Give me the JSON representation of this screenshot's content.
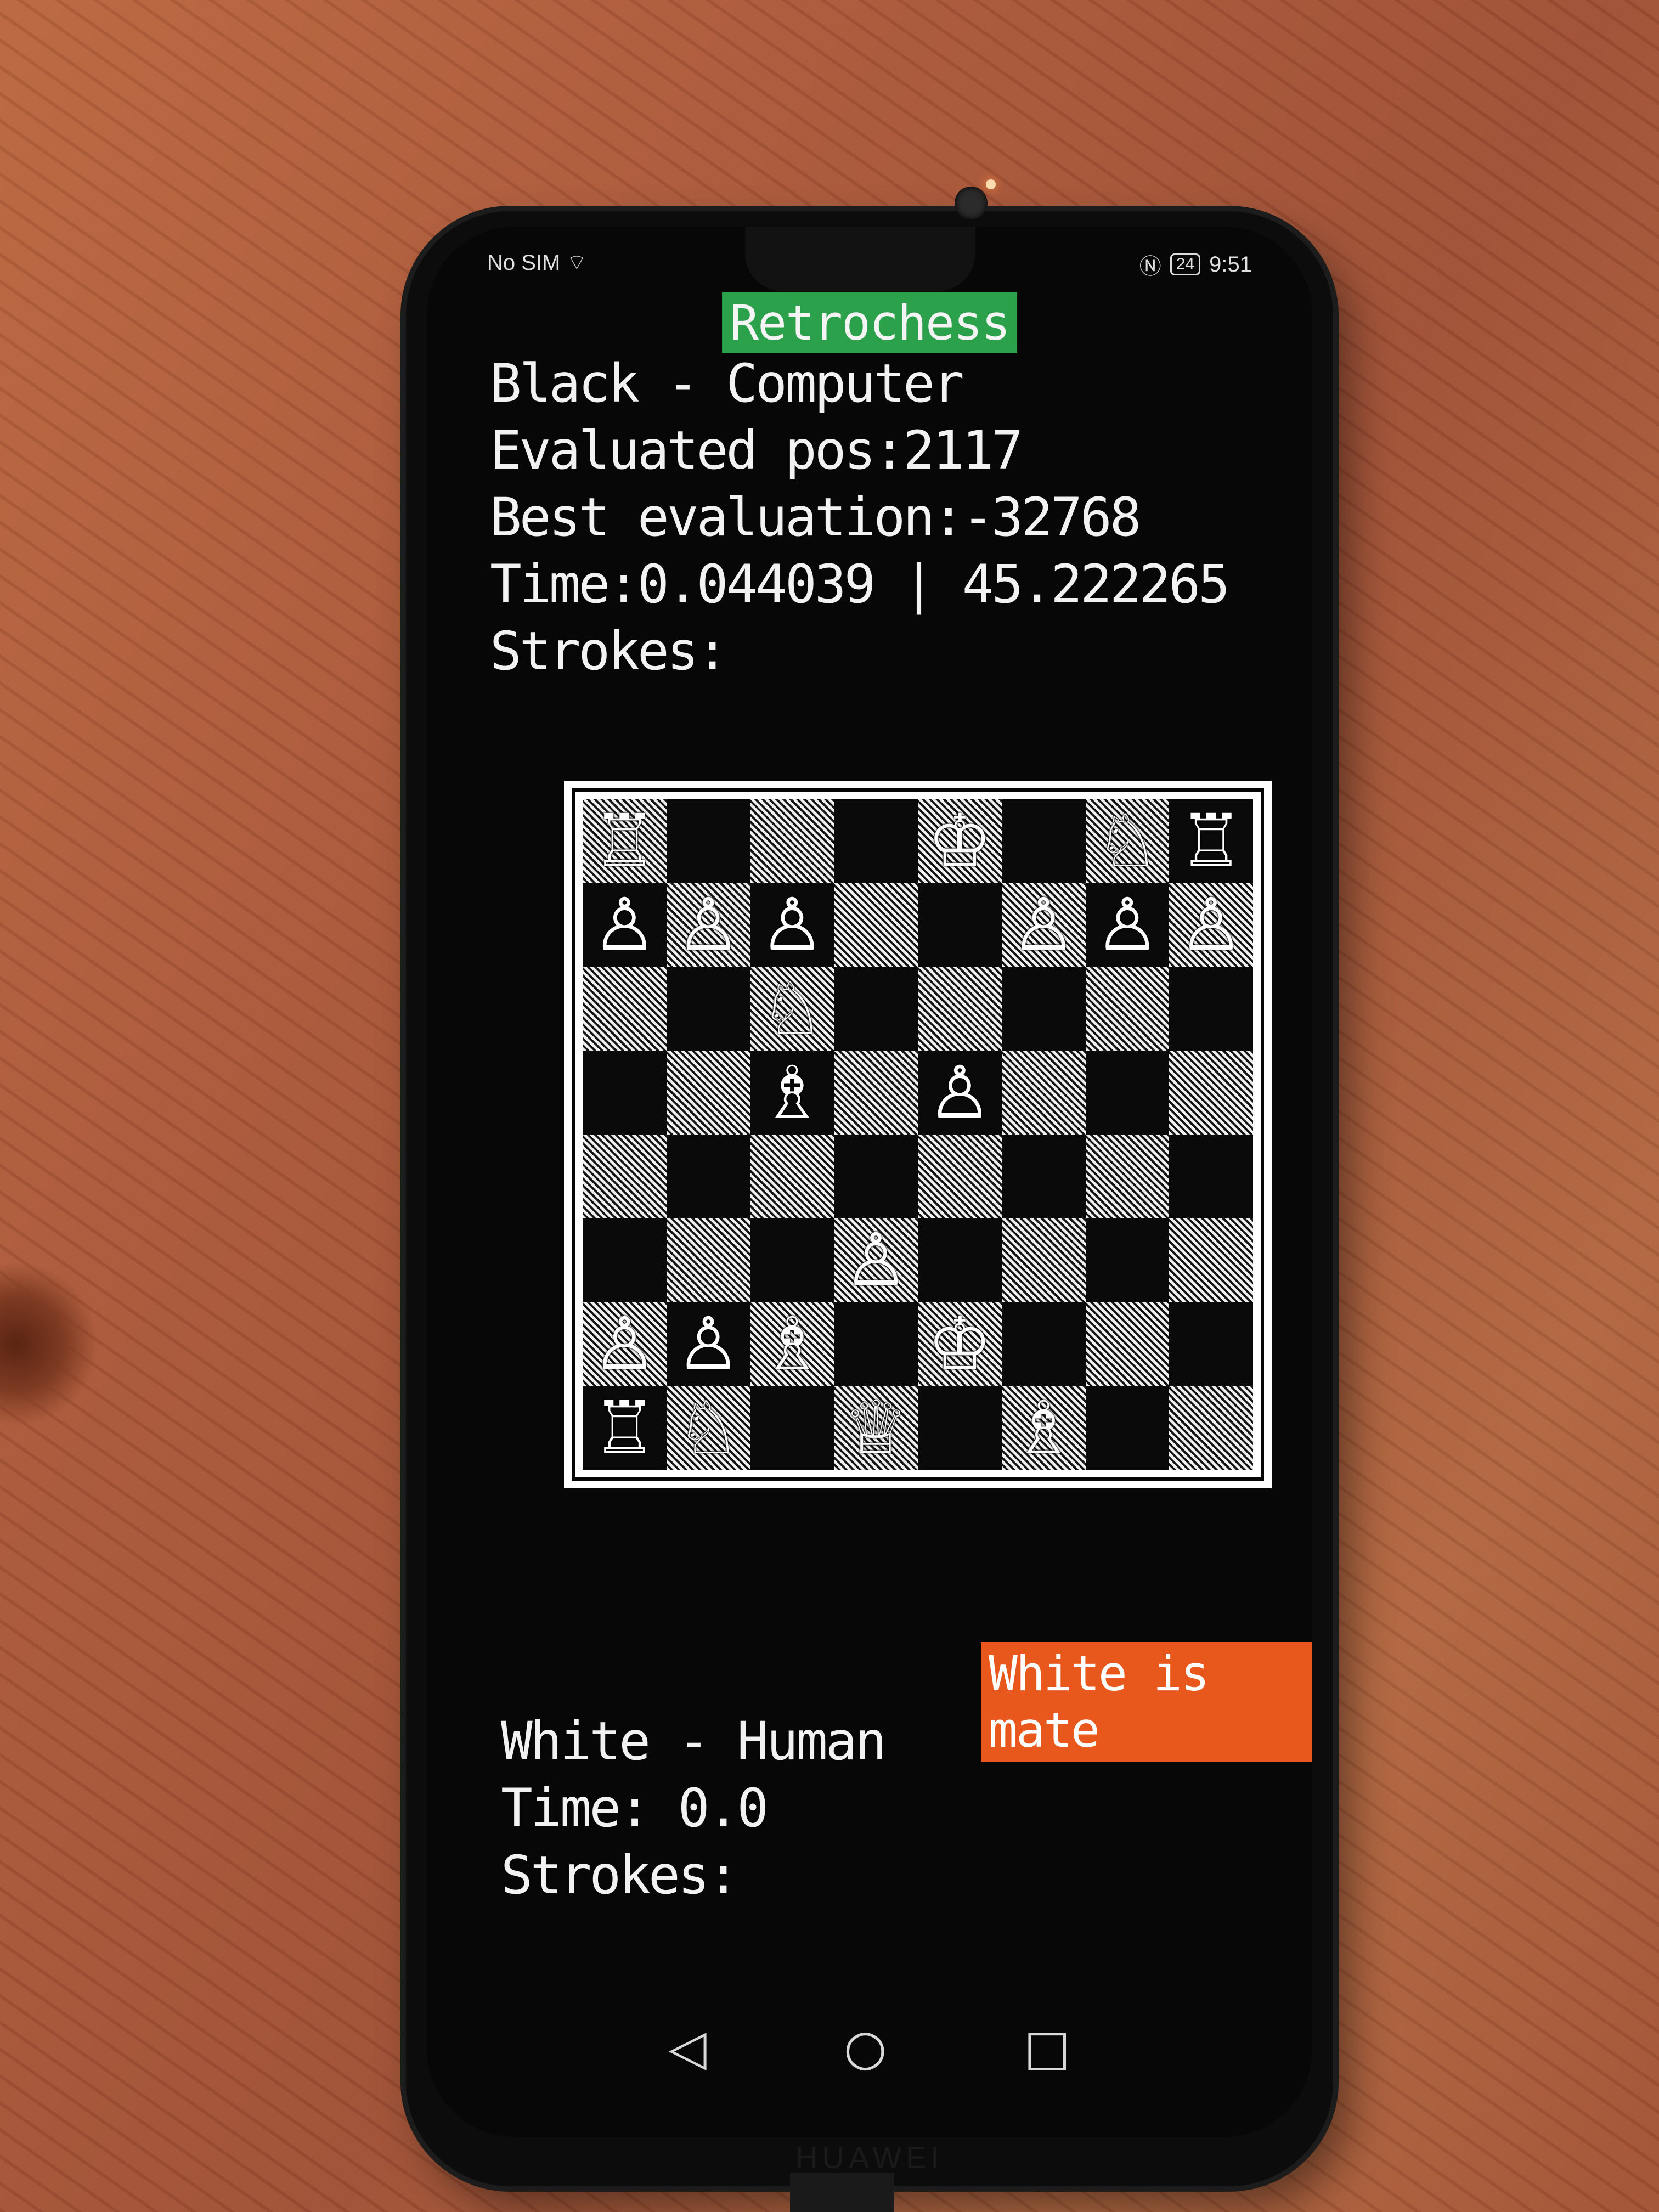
{
  "status_bar": {
    "left": "No SIM",
    "battery": "24",
    "time": "9:51"
  },
  "app": {
    "title": "Retrochess"
  },
  "black_panel": {
    "player": "Black - Computer",
    "evaluated": "Evaluated pos:2117",
    "best": "Best evaluation:-32768",
    "time": "Time:0.044039 | 45.222265",
    "strokes": "Strokes:"
  },
  "board": {
    "rows": [
      [
        "♖",
        "",
        "",
        "",
        "♔",
        "",
        "♘",
        "♖"
      ],
      [
        "♙",
        "♙",
        "♙",
        "",
        "",
        "♙",
        "♙",
        "♙"
      ],
      [
        "",
        "",
        "♘",
        "",
        "",
        "",
        "",
        ""
      ],
      [
        "",
        "",
        "♗",
        "",
        "♙",
        "",
        "",
        ""
      ],
      [
        "",
        "",
        "",
        "",
        "",
        "",
        "",
        ""
      ],
      [
        "",
        "",
        "",
        "♙",
        "",
        "",
        "",
        ""
      ],
      [
        "♙",
        "♙",
        "♗",
        "",
        "♔",
        "",
        "",
        ""
      ],
      [
        "♖",
        "♘",
        "",
        "♕",
        "",
        "♗",
        "",
        ""
      ]
    ]
  },
  "message": {
    "text": "White is mate"
  },
  "white_panel": {
    "player": "White - Human",
    "time": "Time: 0.0",
    "strokes": "Strokes:"
  },
  "nav": {
    "back": "◁",
    "home": "○",
    "recent": "□"
  },
  "device": {
    "brand": "HUAWEI"
  }
}
